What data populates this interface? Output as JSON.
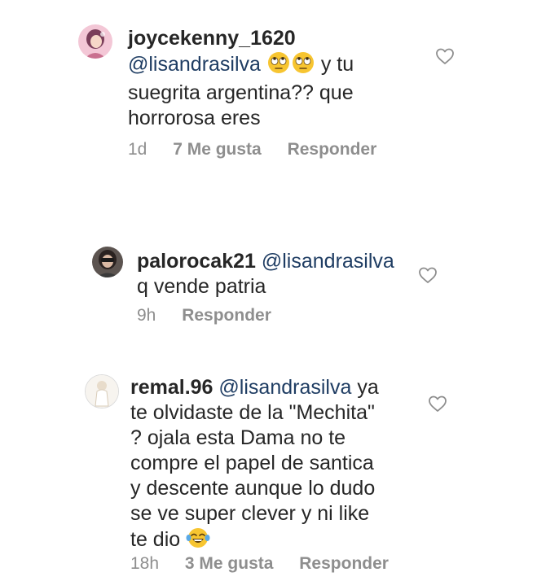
{
  "comments": [
    {
      "username": "joycekenny_1620",
      "mention": "@lisandrasilva",
      "text_after_emoji": "y tu",
      "lines": [
        "suegrita argentina?? que",
        "horrorosa  eres"
      ],
      "time": "1d",
      "likes": "7 Me gusta",
      "reply": "Responder"
    },
    {
      "username": "palorocak21",
      "mention": "@lisandrasilva",
      "lines": [
        "q vende patria"
      ],
      "time": "9h",
      "reply": "Responder"
    },
    {
      "username": "remal.96",
      "mention": "@lisandrasilva",
      "text_after_mention": "ya",
      "lines": [
        "te olvidaste de la \"Mechita\"",
        "? ojala esta  Dama no te",
        "compre el papel de santica",
        "y descente  aunque lo dudo",
        "se ve super clever y ni like",
        "te dio"
      ],
      "time": "18h",
      "likes": "3 Me gusta",
      "reply": "Responder"
    }
  ],
  "colors": {
    "text": "#262626",
    "mention": "#1f3d63",
    "meta": "#8e8e8e"
  },
  "icons": [
    "rolling-eyes-emoji",
    "heart-outline-icon",
    "tears-of-joy-emoji"
  ]
}
